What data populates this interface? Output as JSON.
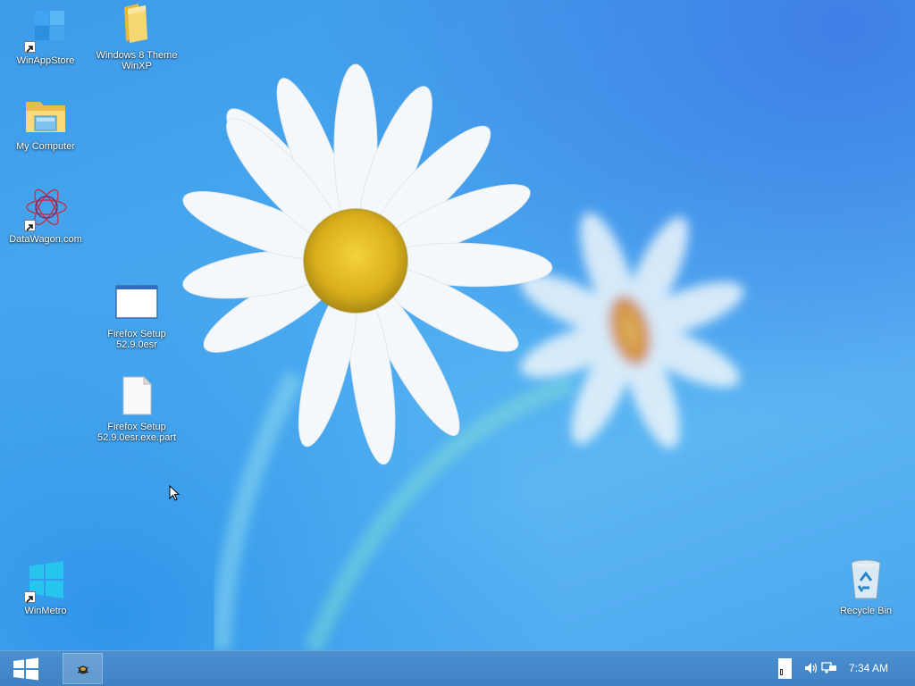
{
  "desktop": {
    "icons": [
      {
        "label": "WinAppStore"
      },
      {
        "label": "Windows 8 Theme\nWinXP"
      },
      {
        "label": "My Computer"
      },
      {
        "label": "DataWagon.com"
      },
      {
        "label": "Firefox Setup\n52.9.0esr"
      },
      {
        "label": "Firefox Setup\n52.9.0esr.exe.part"
      },
      {
        "label": "WinMetro"
      },
      {
        "label": "Recycle Bin"
      }
    ]
  },
  "taskbar": {
    "clock": "7:34 AM"
  },
  "colors": {
    "desktop_blue": "#48a8ef",
    "taskbar_blue": "#4385c7",
    "metro_cyan": "#27c4f0"
  }
}
